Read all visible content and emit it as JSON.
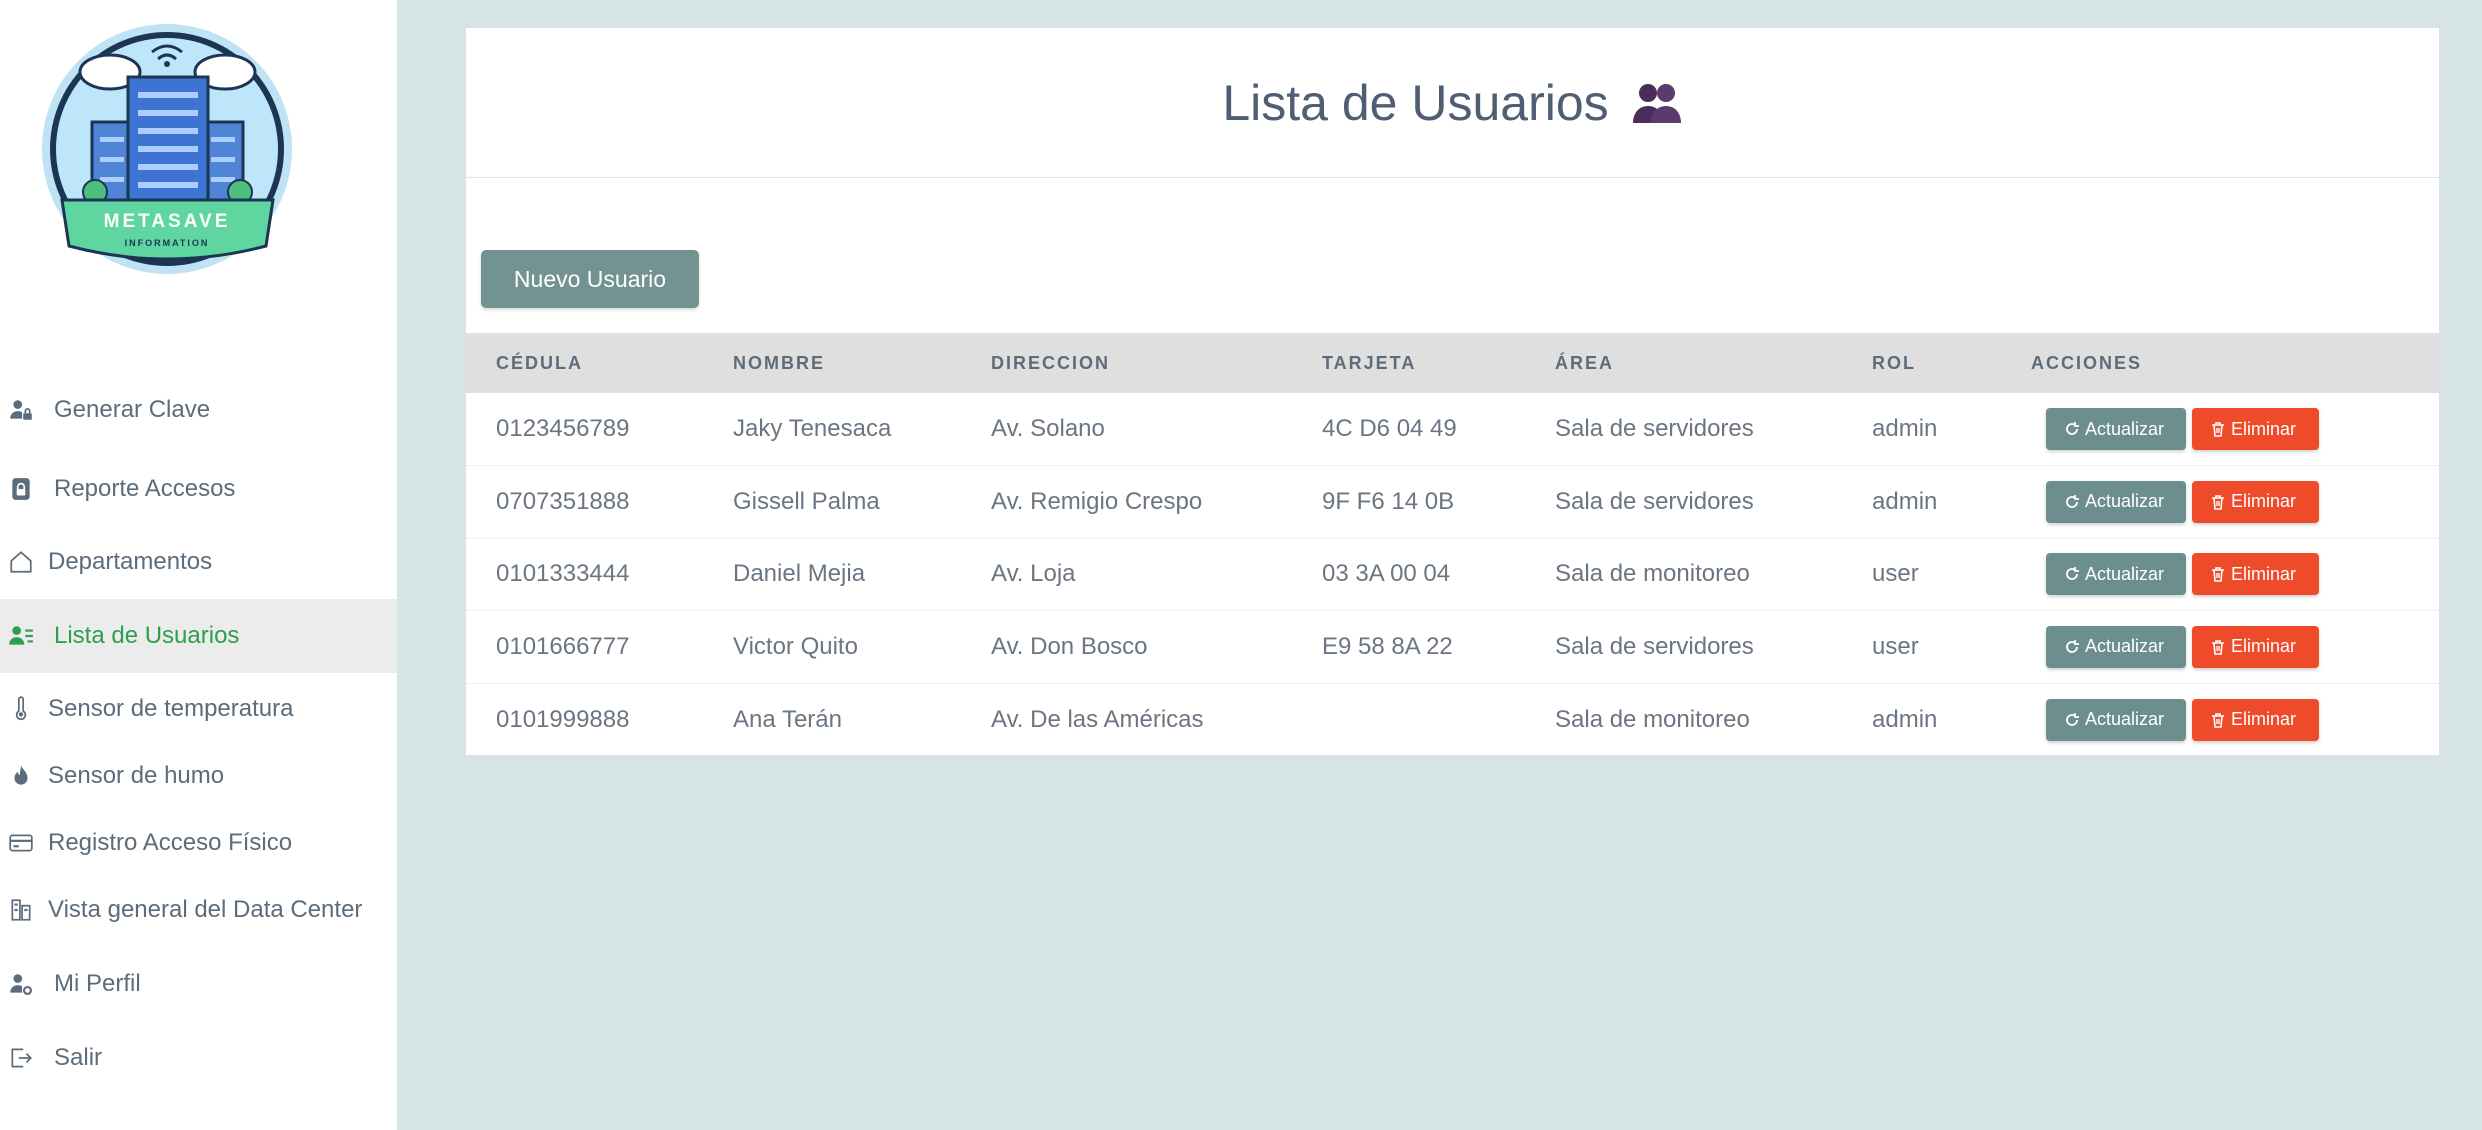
{
  "logo": {
    "text": "METASAVE",
    "subtext": "INFORMATION"
  },
  "sidebar": {
    "items": [
      {
        "label": "Generar Clave",
        "icon": "user-lock-icon"
      },
      {
        "label": "Reporte Accesos",
        "icon": "lock-icon"
      },
      {
        "label": "Departamentos",
        "icon": "home-icon"
      },
      {
        "label": "Lista de Usuarios",
        "icon": "user-list-icon",
        "active": true
      },
      {
        "label": "Sensor de temperatura",
        "icon": "thermometer-icon"
      },
      {
        "label": "Sensor de humo",
        "icon": "fire-icon"
      },
      {
        "label": "Registro Acceso Físico",
        "icon": "card-icon"
      },
      {
        "label": "Vista general del Data Center",
        "icon": "building-icon"
      },
      {
        "label": "Mi Perfil",
        "icon": "user-gear-icon"
      },
      {
        "label": "Salir",
        "icon": "logout-icon"
      }
    ]
  },
  "main": {
    "title": "Lista de Usuarios",
    "title_icon": "users-icon",
    "new_button": "Nuevo Usuario",
    "table": {
      "headers": [
        "CÉDULA",
        "NOMBRE",
        "DIRECCION",
        "TARJETA",
        "ÁREA",
        "ROL",
        "ACCIONES"
      ],
      "rows": [
        {
          "cedula": "0123456789",
          "nombre": "Jaky Tenesaca",
          "direccion": "Av. Solano",
          "tarjeta": "4C D6 04 49",
          "area": "Sala de servidores",
          "rol": "admin"
        },
        {
          "cedula": "0707351888",
          "nombre": "Gissell Palma",
          "direccion": "Av. Remigio Crespo",
          "tarjeta": "9F F6 14 0B",
          "area": "Sala de servidores",
          "rol": "admin"
        },
        {
          "cedula": "0101333444",
          "nombre": "Daniel Mejia",
          "direccion": "Av. Loja",
          "tarjeta": "03 3A 00 04",
          "area": "Sala de monitoreo",
          "rol": "user"
        },
        {
          "cedula": "0101666777",
          "nombre": "Victor Quito",
          "direccion": "Av. Don Bosco",
          "tarjeta": "E9 58 8A 22",
          "area": "Sala de servidores",
          "rol": "user"
        },
        {
          "cedula": "0101999888",
          "nombre": "Ana Terán",
          "direccion": "Av. De las Américas",
          "tarjeta": "",
          "area": "Sala de monitoreo",
          "rol": "admin"
        }
      ],
      "update_label": "Actualizar",
      "delete_label": "Eliminar"
    }
  },
  "colors": {
    "background": "#d6e4e5",
    "active_text": "#2e9e4f",
    "primary_button": "#739393",
    "delete_button": "#ee4b2b"
  }
}
